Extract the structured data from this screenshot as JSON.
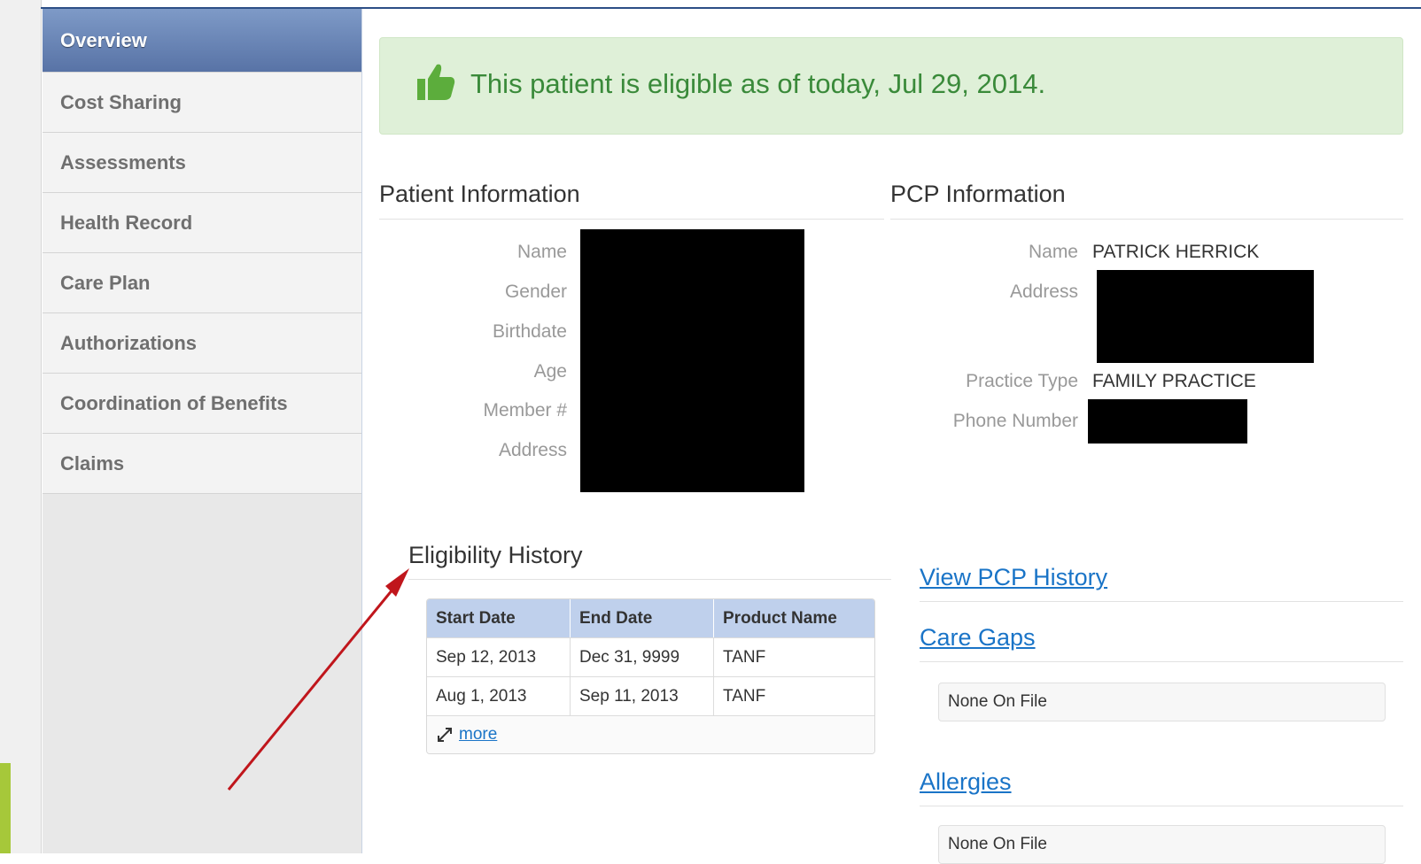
{
  "sidebar": {
    "items": [
      {
        "label": "Overview",
        "active": true
      },
      {
        "label": "Cost Sharing"
      },
      {
        "label": "Assessments"
      },
      {
        "label": "Health Record"
      },
      {
        "label": "Care Plan"
      },
      {
        "label": "Authorizations"
      },
      {
        "label": "Coordination of Benefits"
      },
      {
        "label": "Claims"
      }
    ]
  },
  "banner": {
    "icon": "thumbs-up-icon",
    "message": "This patient is eligible as of today, Jul 29, 2014.",
    "color": "#3a8a3a",
    "background": "#dff0d8"
  },
  "patient_info": {
    "title": "Patient Information",
    "labels": {
      "name": "Name",
      "gender": "Gender",
      "birthdate": "Birthdate",
      "age": "Age",
      "member": "Member #",
      "address": "Address"
    }
  },
  "pcp_info": {
    "title": "PCP Information",
    "labels": {
      "name": "Name",
      "address": "Address",
      "practice_type": "Practice Type",
      "phone": "Phone Number"
    },
    "values": {
      "name": "PATRICK HERRICK",
      "practice_type": "FAMILY PRACTICE"
    }
  },
  "eligibility": {
    "title": "Eligibility History",
    "columns": [
      "Start Date",
      "End Date",
      "Product Name"
    ],
    "rows": [
      [
        "Sep 12, 2013",
        "Dec 31, 9999",
        "TANF"
      ],
      [
        "Aug 1, 2013",
        "Sep 11, 2013",
        "TANF"
      ]
    ],
    "more_label": "more"
  },
  "links": {
    "view_pcp_history": "View PCP History",
    "care_gaps": "Care Gaps",
    "allergies": "Allergies"
  },
  "care_gaps_value": "None On File",
  "allergies_value": "None On File",
  "colors": {
    "accent": "#5873a6",
    "link": "#1a74c7",
    "annotation_arrow": "#c0161c"
  }
}
